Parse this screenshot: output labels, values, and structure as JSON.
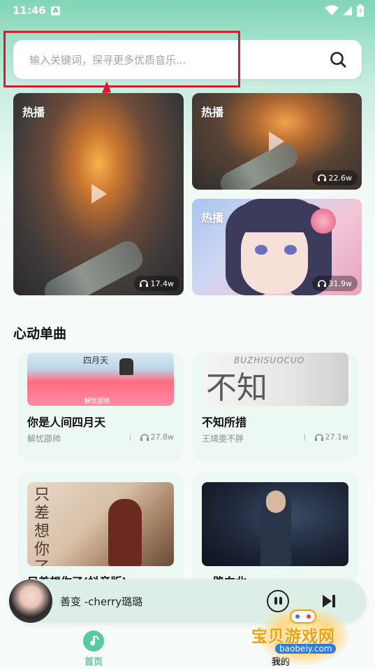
{
  "status_bar": {
    "time": "11:46",
    "notif_letter": "A"
  },
  "search": {
    "placeholder": "输入关键词，探寻更多优质音乐..."
  },
  "featured": [
    {
      "tag": "热播",
      "count": "17.4w"
    },
    {
      "tag": "热播",
      "count": "22.6w"
    },
    {
      "tag": "热播",
      "count": "31.9w"
    }
  ],
  "section": {
    "title": "心动单曲"
  },
  "songs": [
    {
      "title": "你是人间四月天",
      "artist": "解忧邵帅",
      "count": "27.8w",
      "cover_text": "四月天",
      "cover_sub": "解忧邵帅"
    },
    {
      "title": "不知所措",
      "artist": "王靖雯不胖",
      "count": "27.1w",
      "cover_text": "不知",
      "cover_sub": "BUZHISUOCUO"
    },
    {
      "title": "只差想你了(抖音版)",
      "artist": "",
      "count": "",
      "cover_text": "只差想你了"
    },
    {
      "title": "一路向北",
      "artist": "",
      "count": ""
    }
  ],
  "player": {
    "title": "善变 -cherry璐璐"
  },
  "tabs": [
    {
      "label": "首页"
    },
    {
      "label": "我的"
    }
  ],
  "watermark": {
    "main": "宝贝游戏网",
    "sub": "baobeiy.com"
  },
  "colors": {
    "accent": "#58c9a0",
    "annotation": "#d0202c"
  }
}
